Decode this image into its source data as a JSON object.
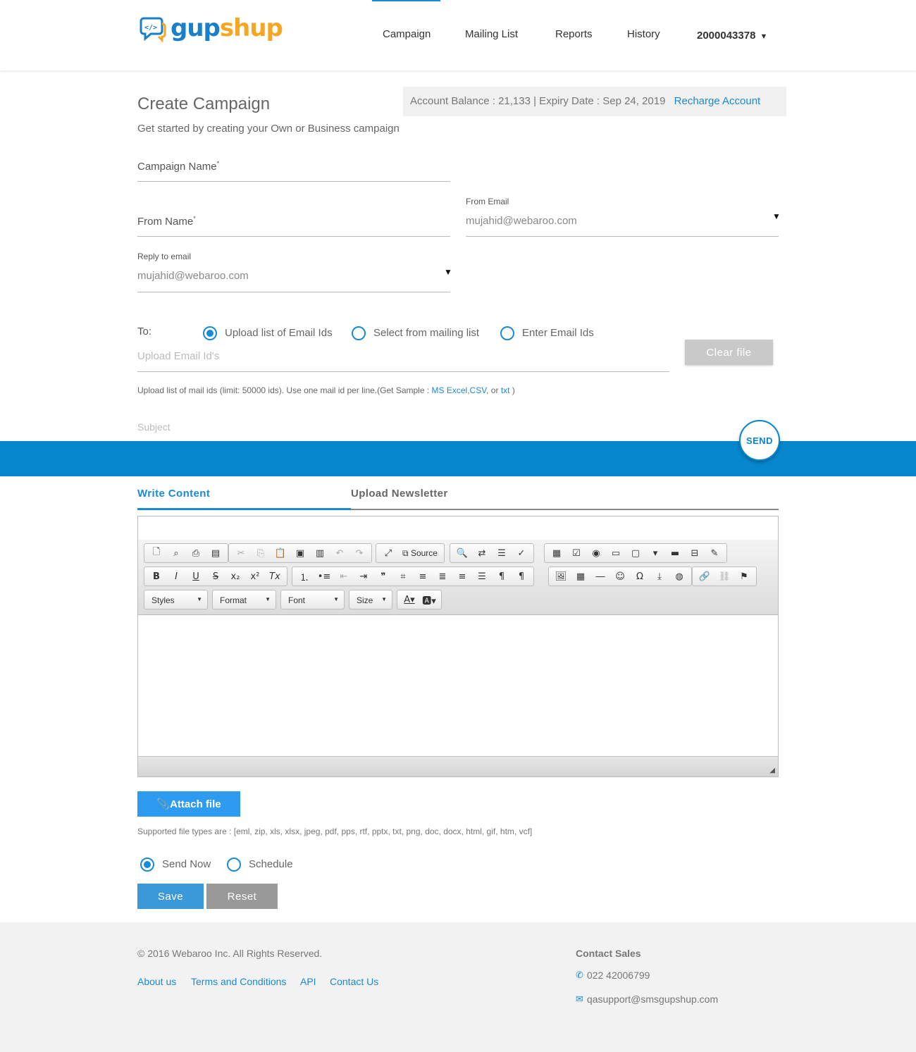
{
  "brand": {
    "part1": "gup",
    "part2": "shup"
  },
  "nav": {
    "campaign": "Campaign",
    "mailing_list": "Mailing List",
    "reports": "Reports",
    "history": "History",
    "account": "2000043378"
  },
  "page": {
    "title": "Create Campaign",
    "subtitle": "Get started by creating your Own or Business campaign",
    "balance": "Account Balance : 21,133 | Expiry Date : Sep 24, 2019",
    "recharge": "Recharge Account"
  },
  "form": {
    "campaign_name_label": "Campaign Name",
    "from_name_label": "From Name",
    "from_email_label": "From Email",
    "from_email_value": "mujahid@webaroo.com",
    "reply_label": "Reply to email",
    "reply_value": "mujahid@webaroo.com",
    "to_label": "To:",
    "radio_upload": "Upload list of Email Ids",
    "radio_select": "Select from mailing list",
    "radio_enter": "Enter Email Ids",
    "upload_placeholder": "Upload Email Id's",
    "clear_file": "Clear file",
    "hint_prefix": "Upload list of mail ids (limit: 50000 ids). Use one mail id per line.(Get Sample :",
    "hint_ms": "MS Excel",
    "hint_csv": "CSV",
    "hint_or": ", or",
    "hint_txt": "txt",
    "hint_close": ")",
    "subject_placeholder": "Subject",
    "send": "SEND"
  },
  "tabs": {
    "write": "Write Content",
    "upload": "Upload Newsletter"
  },
  "editor": {
    "source": "Source",
    "styles": "Styles",
    "format": "Format",
    "font": "Font",
    "size": "Size"
  },
  "bottom": {
    "attach": "Attach file",
    "supported": "Supported file types are : [eml, zip, xls, xlsx, jpeg, pdf, pps, rtf, pptx, txt, png, doc, docx, html, gif, htm, vcf]",
    "send_now": "Send Now",
    "schedule": "Schedule",
    "save": "Save",
    "reset": "Reset"
  },
  "footer": {
    "copyright": "© 2016 Webaroo Inc. All Rights Reserved.",
    "about": "About us",
    "terms": "Terms and Conditions",
    "api": "API",
    "contact": "Contact Us",
    "contact_sales": "Contact Sales",
    "phone": "022 42006799",
    "email": "qasupport@smsgupshup.com"
  },
  "colors": {
    "accent": "#0686cc",
    "brand_blue": "#1a7fc9",
    "brand_orange": "#f5a623"
  },
  "icons": [
    "chat-code-icon",
    "caret-down-icon",
    "paperclip-icon",
    "phone-icon",
    "mail-icon",
    "resize-handle-icon"
  ]
}
